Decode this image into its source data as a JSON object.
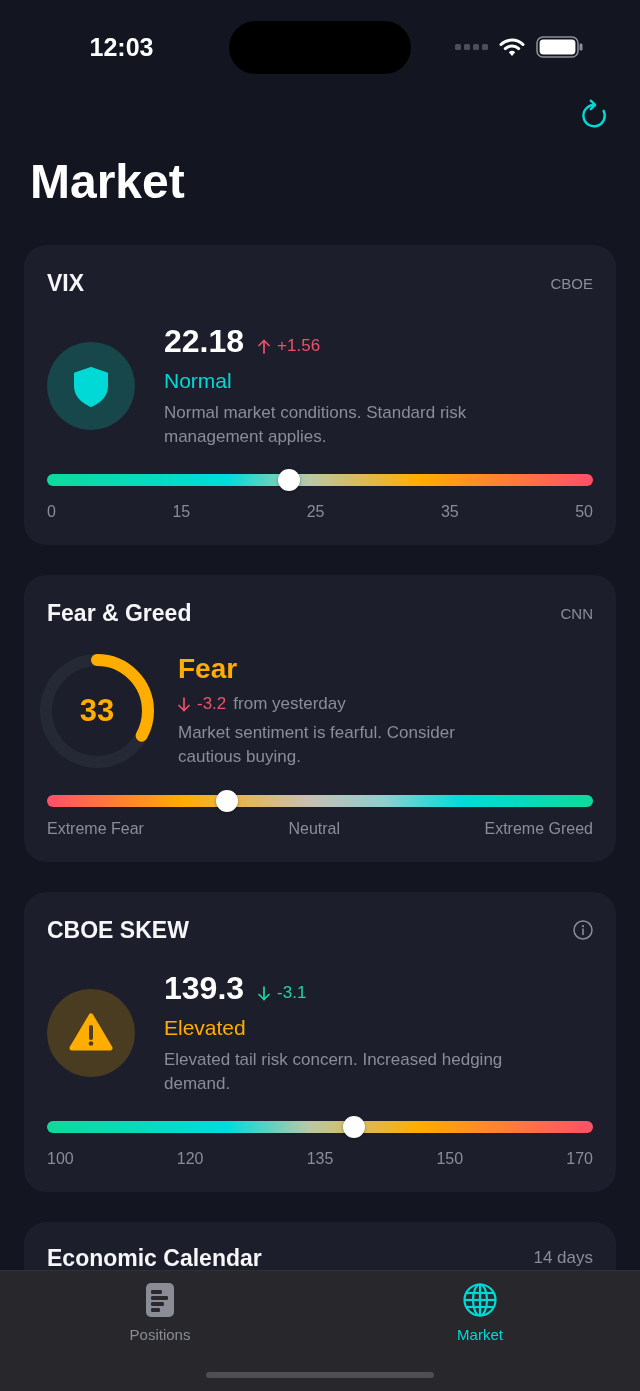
{
  "status_bar": {
    "time": "12:03"
  },
  "header": {
    "title": "Market"
  },
  "cards": [
    {
      "kind": "index",
      "title": "VIX",
      "source": "CBOE",
      "value": "22.18",
      "change": {
        "rising": true,
        "favorable": false,
        "value": "+1.56"
      },
      "status": {
        "warning": false,
        "label": "Normal"
      },
      "description": "Normal market conditions. Standard risk management applies.",
      "gauge": {
        "reversed": false,
        "level": 0.443,
        "labels": [
          "0",
          "15",
          "25",
          "35",
          "50"
        ]
      }
    },
    {
      "kind": "sentiment",
      "title": "Fear & Greed",
      "source": "CNN",
      "score": "33",
      "ring": {
        "level": 0.33
      },
      "status": {
        "warning": true,
        "label": "Fear"
      },
      "change": {
        "rising": false,
        "favorable": false,
        "value": "-3.2",
        "suffix": "from yesterday"
      },
      "description": "Market sentiment is fearful. Consider cautious buying.",
      "gauge": {
        "reversed": true,
        "level": 0.33,
        "labels": [
          "Extreme Fear",
          "Neutral",
          "Extreme Greed"
        ]
      }
    },
    {
      "kind": "index",
      "title": "CBOE SKEW",
      "info": true,
      "value": "139.3",
      "change": {
        "rising": false,
        "favorable": true,
        "value": "-3.1"
      },
      "status": {
        "warning": true,
        "label": "Elevated"
      },
      "description": "Elevated tail risk concern. Increased hedging demand.",
      "gauge": {
        "reversed": false,
        "level": 0.562,
        "labels": [
          "100",
          "120",
          "135",
          "150",
          "170"
        ]
      }
    },
    {
      "kind": "calendar",
      "title": "Economic Calendar",
      "range": "14 days"
    }
  ],
  "tab_bar": {
    "tabs": [
      {
        "label": "Positions",
        "selected": false
      },
      {
        "label": "Market",
        "selected": true
      }
    ]
  }
}
